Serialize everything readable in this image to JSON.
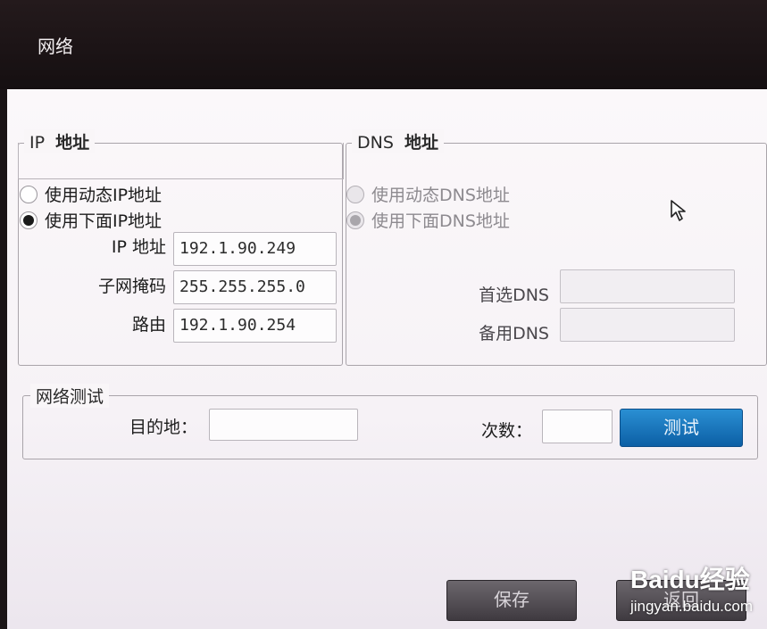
{
  "window": {
    "title": "网络"
  },
  "ip_section": {
    "legend_prefix": "IP",
    "legend_bold": "地址",
    "radio_dynamic": "使用动态IP地址",
    "radio_manual": "使用下面IP地址",
    "selected": "manual",
    "fields": [
      {
        "label": "IP  地址",
        "value": "192.1.90.249"
      },
      {
        "label": "子网掩码",
        "value": "255.255.255.0"
      },
      {
        "label": "路由",
        "value": "192.1.90.254"
      }
    ]
  },
  "dns_section": {
    "legend_prefix": "DNS",
    "legend_bold": "地址",
    "radio_dynamic": "使用动态DNS地址",
    "radio_manual": "使用下面DNS地址",
    "enabled": false,
    "fields": [
      {
        "label": "首选DNS",
        "value": ""
      },
      {
        "label": "备用DNS",
        "value": ""
      }
    ]
  },
  "net_test": {
    "legend": "网络测试",
    "destination_label": "目的地：",
    "destination_value": "",
    "count_label": "次数：",
    "count_value": "",
    "test_button": "测试"
  },
  "footer": {
    "save_button": "保存",
    "return_button": "返回"
  },
  "watermark": {
    "logo_text": "Baidu经验",
    "url": "jingyan.baidu.com"
  },
  "colors": {
    "accent_button": "#1a78c2",
    "title_bar": "#1d1517",
    "panel_bg": "#f8f5f8"
  },
  "icons": [
    "mouse-pointer-icon",
    "radio-selected-icon",
    "radio-unselected-icon",
    "baidu-paw-icon"
  ]
}
